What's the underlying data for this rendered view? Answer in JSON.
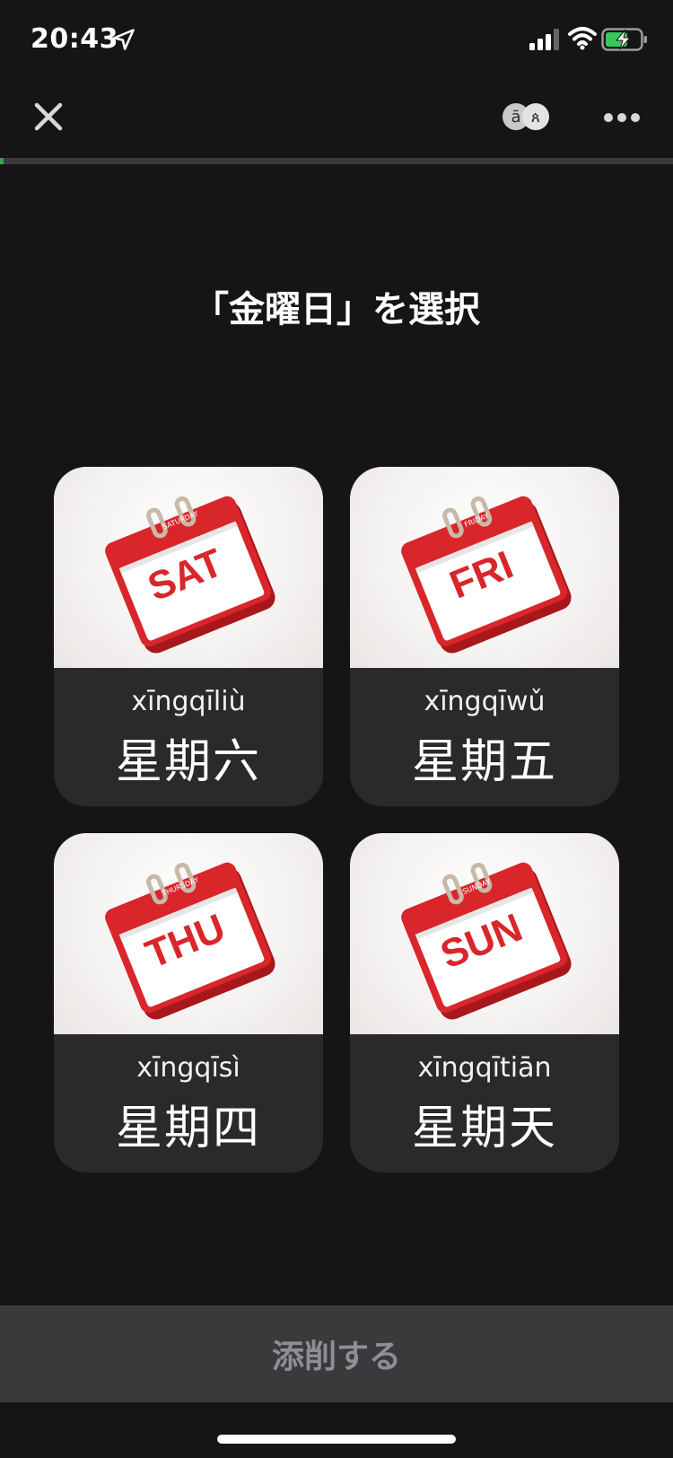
{
  "status": {
    "time": "20:43"
  },
  "header": {
    "close_icon": "close-icon",
    "lang_icon": "language-toggle-icon",
    "more_icon": "more-icon",
    "progress_fraction": 0.005,
    "progress_color": "#3aa14a"
  },
  "prompt": {
    "title": "「金曜日」を選択"
  },
  "options": [
    {
      "pinyin": "xīngqīliù",
      "hanzi": "星期六",
      "calendar_label": "SAT",
      "calendar_header": "SATURDAY"
    },
    {
      "pinyin": "xīngqīwǔ",
      "hanzi": "星期五",
      "calendar_label": "FRI",
      "calendar_header": "FRIDAY"
    },
    {
      "pinyin": "xīngqīsì",
      "hanzi": "星期四",
      "calendar_label": "THU",
      "calendar_header": "THURSDAY"
    },
    {
      "pinyin": "xīngqītiān",
      "hanzi": "星期天",
      "calendar_label": "SUN",
      "calendar_header": "SUNDAY"
    }
  ],
  "footer": {
    "submit_label": "添削する"
  },
  "colors": {
    "background": "#151517",
    "card": "#2a2a2c",
    "calendar_red": "#d9262a"
  }
}
